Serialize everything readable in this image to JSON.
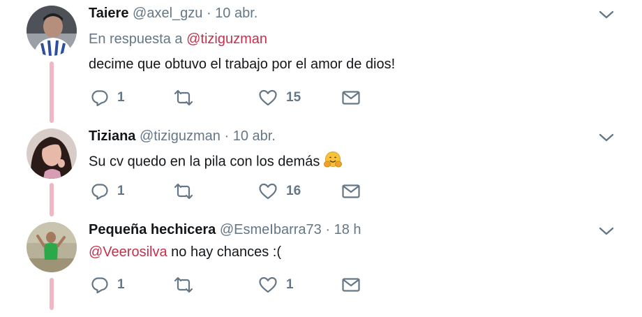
{
  "tweets": [
    {
      "name": "Taiere",
      "handle": "@axel_gzu",
      "time": "10 abr.",
      "reply_prefix": "En respuesta a",
      "reply_to": "@tiziguzman",
      "text": "decime que obtuvo el trabajo por el amor de dios!",
      "replies": "1",
      "retweets": "",
      "likes": "15"
    },
    {
      "name": "Tiziana",
      "handle": "@tiziguzman",
      "time": "10 abr.",
      "text": "Su cv quedo en la pila con los demás",
      "emoji": "hugging-face-emoji",
      "replies": "1",
      "retweets": "",
      "likes": "16"
    },
    {
      "name": "Pequeña hechicera",
      "handle": "@EsmeIbarra73",
      "time": "18 h",
      "mention": "@Veerosilva",
      "text": "no hay chances :(",
      "replies": "1",
      "retweets": "",
      "likes": "1"
    }
  ],
  "separator": "·",
  "colors": {
    "thread_line": "#f1b8c3",
    "mention": "#c6304c",
    "secondary_text": "#657786",
    "icon": "#657786"
  },
  "icons": [
    "reply-icon",
    "retweet-icon",
    "like-icon",
    "direct-message-icon",
    "chevron-down-icon"
  ]
}
